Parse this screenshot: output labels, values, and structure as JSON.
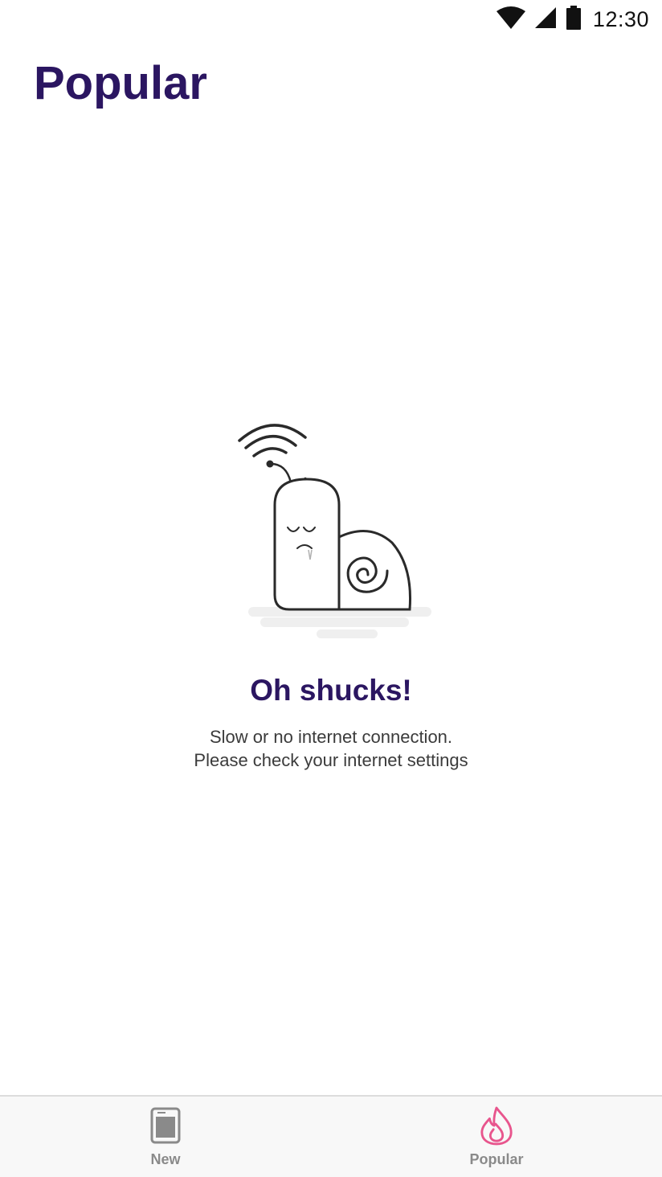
{
  "status_bar": {
    "time": "12:30",
    "icons": [
      "wifi-icon",
      "cellular-signal-icon",
      "battery-icon"
    ]
  },
  "header": {
    "title": "Popular"
  },
  "empty_state": {
    "illustration": "snail-no-connection-illustration",
    "title": "Oh shucks!",
    "message_line1": "Slow or no internet connection.",
    "message_line2": "Please check your internet settings"
  },
  "bottom_nav": {
    "items": [
      {
        "label": "New",
        "icon": "tablet-icon",
        "active": false
      },
      {
        "label": "Popular",
        "icon": "flame-icon",
        "active": true
      }
    ]
  },
  "colors": {
    "title": "#2b1661",
    "active_tab_icon": "#e8558d",
    "inactive_tab": "#8a8a8a"
  }
}
